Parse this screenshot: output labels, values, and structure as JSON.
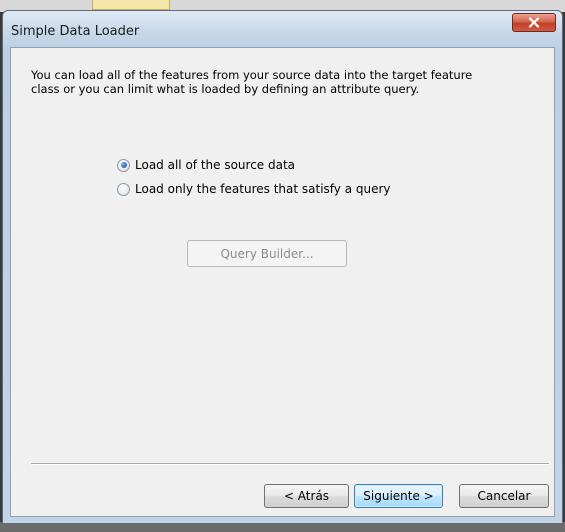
{
  "window": {
    "title": "Simple Data Loader",
    "close_icon": "close-icon"
  },
  "content": {
    "description": "You can load all of the features from your source data into the target feature class or you can limit what is loaded by defining an attribute query.",
    "options": [
      {
        "label": "Load all of the source data",
        "selected": true
      },
      {
        "label": "Load only the features that satisfy a query",
        "selected": false
      }
    ],
    "query_builder_label": "Query Builder...",
    "query_builder_enabled": false
  },
  "footer": {
    "back_label": "< Atrás",
    "next_label": "Siguiente >",
    "cancel_label": "Cancelar"
  },
  "colors": {
    "accent": "#3c7fb1",
    "close_button": "#c2412a"
  }
}
